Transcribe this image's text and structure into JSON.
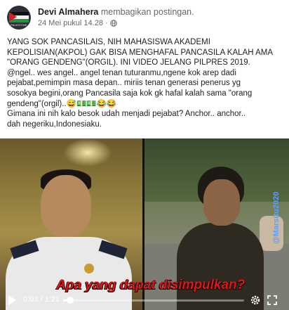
{
  "post": {
    "author": "Devi Almahera",
    "action": "membagikan postingan.",
    "date": "24 Mei pukul 14.28",
    "separator": "·",
    "avatar_caption": "PALESTINE",
    "text_lines": [
      "YANG SOK PANCASILAIS, NIH MAHASISWA AKADEMI",
      "KEPOLISIAN(AKPOL) GAK BISA MENGHAFAL PANCASILA KALAH AMA",
      "\"ORANG GENDENG\"(ORGIL). INI VIDEO JELANG PILPRES 2019.",
      "@ngel.. wes angel.. angel tenan tuturanmu,ngene kok arep dadi",
      "pejabat,pemimpin masa depan.. miriis tenan generasi penerus yg",
      "sosokya begini,orang Pancasila saja kok gk hafal kalah sama \"orang",
      "gendeng\"(orgil)..😅💵💵😂😂",
      "Gimana ini nih kalo besok udah menjadi pejabat? Anchor.. anchor..",
      "dah negeriku,Indonesiaku."
    ]
  },
  "video": {
    "overlay_caption": "Apa yang dapat disimpulkan?",
    "watermark": "@Marsitu2020",
    "time_display": "0:03 / 1:21",
    "progress": 0.037
  },
  "icons": {
    "globe": "globe-icon",
    "play": "play-icon",
    "settings": "gear-icon",
    "fullscreen": "fullscreen-icon",
    "avatar": "palestine-flag-icon"
  },
  "colors": {
    "caption_red": "#e01616",
    "watermark_blue": "#5aa0ff",
    "meta_gray": "#65676b"
  }
}
